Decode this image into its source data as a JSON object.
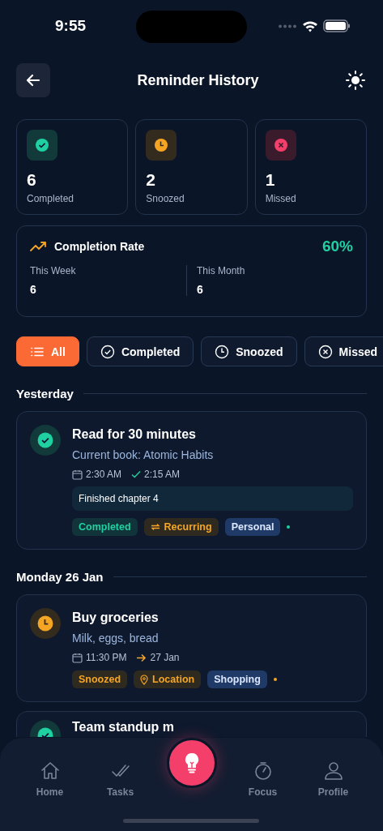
{
  "status_bar": {
    "time": "9:55"
  },
  "header": {
    "title": "Reminder History"
  },
  "stats": [
    {
      "kind": "completed",
      "count": "6",
      "label": "Completed"
    },
    {
      "kind": "snoozed",
      "count": "2",
      "label": "Snoozed"
    },
    {
      "kind": "missed",
      "count": "1",
      "label": "Missed"
    }
  ],
  "completion": {
    "title": "Completion Rate",
    "rate": "60%",
    "periods": [
      {
        "label": "This Week",
        "value": "6"
      },
      {
        "label": "This Month",
        "value": "6"
      }
    ]
  },
  "filters": [
    {
      "kind": "all",
      "label": "All",
      "selected": true
    },
    {
      "kind": "completed",
      "label": "Completed",
      "selected": false
    },
    {
      "kind": "snoozed",
      "label": "Snoozed",
      "selected": false
    },
    {
      "kind": "missed",
      "label": "Missed",
      "selected": false
    }
  ],
  "sections": [
    {
      "heading": "Yesterday",
      "reminders": [
        {
          "kind": "completed",
          "title": "Read for 30 minutes",
          "subtitle": "Current book: Atomic Habits",
          "scheduled": "2:30 AM",
          "outcome": {
            "kind": "done",
            "time": "2:15 AM"
          },
          "note": "Finished chapter 4",
          "dot": {
            "color": "#1fd1a0"
          },
          "tags": [
            {
              "kind": "status",
              "label": "Completed",
              "color": "#11333a"
            },
            {
              "kind": "repeat",
              "label": "Recurring",
              "color": "#2f2a20"
            },
            {
              "kind": "category",
              "label": "Personal",
              "color": "#1f3a66"
            }
          ]
        }
      ]
    },
    {
      "heading": "Monday 26 Jan",
      "reminders": [
        {
          "kind": "snoozed",
          "title": "Buy groceries",
          "subtitle": "Milk, eggs, bread",
          "scheduled": "11:30 PM",
          "outcome": {
            "kind": "moved",
            "time": "27 Jan"
          },
          "dot": {
            "color": "#f5a524"
          },
          "tags": [
            {
              "kind": "status",
              "label": "Snoozed",
              "color": "#2f2a20"
            },
            {
              "kind": "location",
              "label": "Location",
              "color": "#2f2a20"
            },
            {
              "kind": "category",
              "label": "Shopping",
              "color": "#1f3a66"
            }
          ]
        },
        {
          "kind": "completed",
          "title": "Team standup m"
        }
      ]
    }
  ],
  "nav": [
    {
      "kind": "home",
      "label": "Home",
      "selected": false
    },
    {
      "kind": "tasks",
      "label": "Tasks",
      "selected": false
    },
    {
      "kind": "fab"
    },
    {
      "kind": "focus",
      "label": "Focus",
      "selected": false
    },
    {
      "kind": "profile",
      "label": "Profile",
      "selected": false
    }
  ]
}
